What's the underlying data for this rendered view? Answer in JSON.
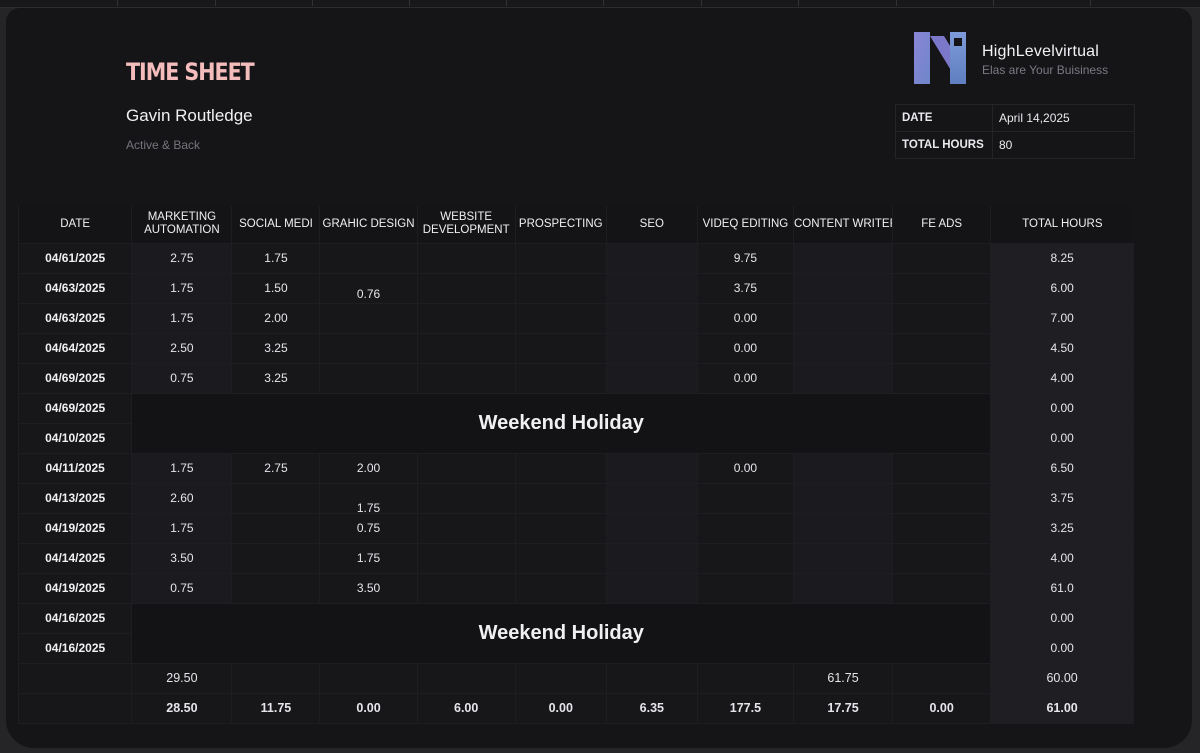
{
  "title": "TIME SHEET",
  "employee": {
    "name": "Gavin Routledge",
    "subtitle": "Active & Back"
  },
  "brand": {
    "name": "HighLevelvirtual",
    "tagline": "Elas are Your Buisiness"
  },
  "info": [
    {
      "label": "DATE",
      "value": "April 14,2025"
    },
    {
      "label": "TOTAL HOURS",
      "value": "80"
    }
  ],
  "columns": [
    "DATE",
    "MARKETING AUTOMATION",
    "SOCIAL MEDI",
    "GRAHIC DESIGN",
    "WEBSITE DEVELOPMENT",
    "PROSPECTING",
    "SEO",
    "VIDEQ EDITING",
    "CONTENT WRITER",
    "FE ADS",
    "TOTAL HOURS"
  ],
  "column_header_lines": [
    [
      "DATE"
    ],
    [
      "MARKETING",
      "AUTOMATION"
    ],
    [
      "SOCIAL MEDI"
    ],
    [
      "GRAHIC DESIGN"
    ],
    [
      "WEBSITE",
      "DEVELOPMENT"
    ],
    [
      "PROSPECTING"
    ],
    [
      "SEO"
    ],
    [
      "VIDEQ EDITING"
    ],
    [
      "CONTENT WRITER"
    ],
    [
      "FE ADS"
    ],
    [
      "TOTAL HOURS"
    ]
  ],
  "rows": [
    [
      "04/61/2025",
      "2.75",
      "1.75",
      "",
      "",
      "",
      "",
      "9.75",
      "",
      "",
      "8.25"
    ],
    [
      "04/63/2025",
      "1.75",
      "1.50",
      "0.76",
      "",
      "",
      "",
      "3.75",
      "",
      "",
      "6.00"
    ],
    [
      "04/63/2025",
      "1.75",
      "2.00",
      "",
      "",
      "",
      "",
      "0.00",
      "",
      "",
      "7.00"
    ],
    [
      "04/64/2025",
      "2.50",
      "3.25",
      "",
      "",
      "",
      "",
      "0.00",
      "",
      "",
      "4.50"
    ],
    [
      "04/69/2025",
      "0.75",
      "3.25",
      "",
      "",
      "",
      "",
      "0.00",
      "",
      "",
      "4.00"
    ],
    [
      "04/69/2025",
      "",
      "",
      "",
      "",
      "",
      "",
      "",
      "",
      "",
      "0.00"
    ],
    [
      "04/10/2025",
      "",
      "",
      "",
      "",
      "",
      "",
      "",
      "",
      "",
      "0.00"
    ],
    [
      "04/11/2025",
      "1.75",
      "2.75",
      "2.00",
      "",
      "",
      "",
      "0.00",
      "",
      "",
      "6.50"
    ],
    [
      "04/13/2025",
      "2.60",
      "",
      "1.75",
      "",
      "",
      "",
      "",
      "",
      "",
      "3.75"
    ],
    [
      "04/19/2025",
      "1.75",
      "",
      "0.75",
      "",
      "",
      "",
      "",
      "",
      "",
      "3.25"
    ],
    [
      "04/14/2025",
      "3.50",
      "",
      "1.75",
      "",
      "",
      "",
      "",
      "",
      "",
      "4.00"
    ],
    [
      "04/19/2025",
      "0.75",
      "",
      "3.50",
      "",
      "",
      "",
      "",
      "",
      "",
      "61.0"
    ],
    [
      "04/16/2025",
      "",
      "",
      "",
      "",
      "",
      "",
      "",
      "",
      "",
      "0.00"
    ],
    [
      "04/16/2025",
      "",
      "",
      "",
      "",
      "",
      "",
      "",
      "",
      "",
      "0.00"
    ]
  ],
  "holiday_label": "Weekend Holiday",
  "subtotal_row": [
    "",
    "29.50",
    "",
    "",
    "",
    "",
    "",
    "",
    "61.75",
    "",
    "60.00"
  ],
  "total_row": [
    "",
    "28.50",
    "11.75",
    "0.00",
    "6.00",
    "0.00",
    "6.35",
    "177.5",
    "17.75",
    "0.00",
    "61.00"
  ]
}
